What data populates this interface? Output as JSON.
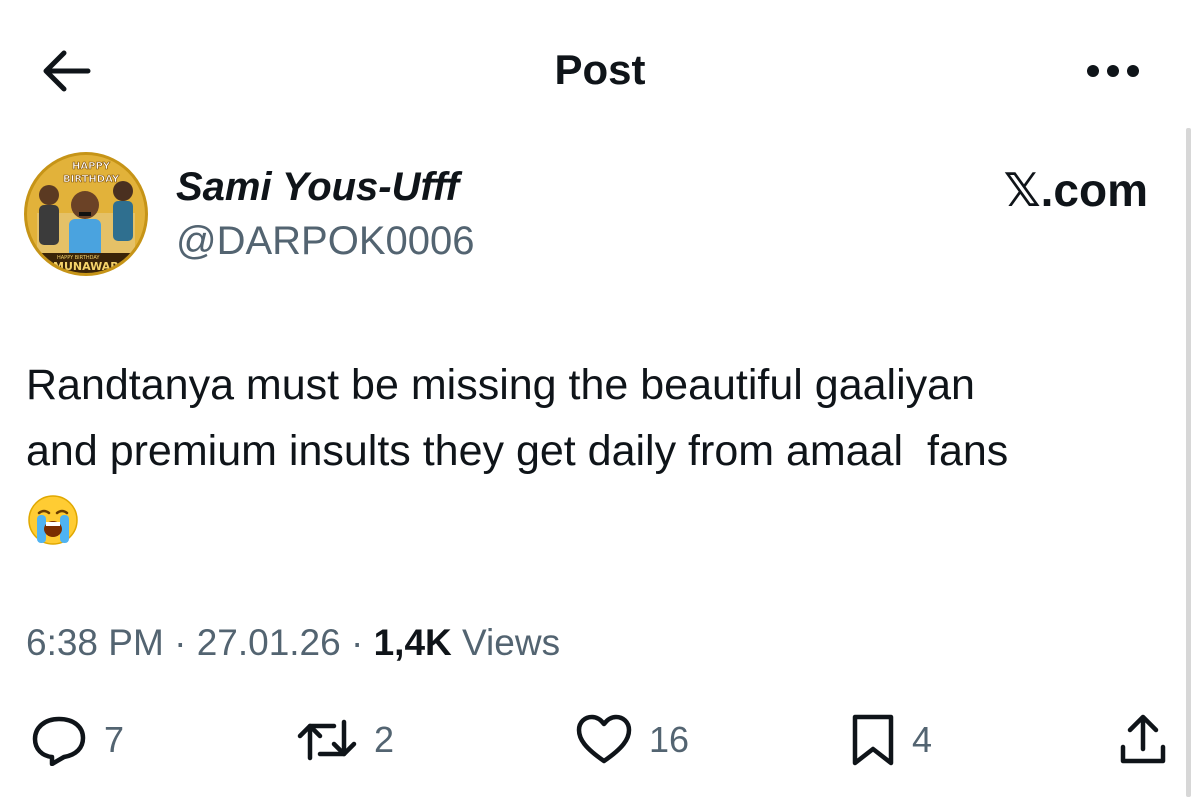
{
  "header": {
    "title": "Post",
    "back_icon": "arrow-left-icon",
    "more_icon": "more-horizontal-icon"
  },
  "author": {
    "name": "Sami Yous-Ufff",
    "handle": "@DARPOK0006",
    "avatar_lines": [
      "HAPPY",
      "BIRTHDAY",
      "HAPPY BIRTHDAY",
      "MUNAWAR"
    ]
  },
  "watermark": "𝕏.com",
  "post": {
    "text": "Randtanya must be missing the beautiful gaaliyan\nand premium insults they get daily from amaal  fans\n",
    "emoji": "loudly-crying-face"
  },
  "meta": {
    "time": "6:38 PM",
    "separator": " · ",
    "date": "27.01.26",
    "views_count": "1,4K",
    "views_label": "Views"
  },
  "actions": {
    "replies": "7",
    "reposts": "2",
    "likes": "16",
    "bookmarks": "4"
  },
  "colors": {
    "text_primary": "#0f1419",
    "text_secondary": "#536471",
    "background": "#ffffff"
  }
}
